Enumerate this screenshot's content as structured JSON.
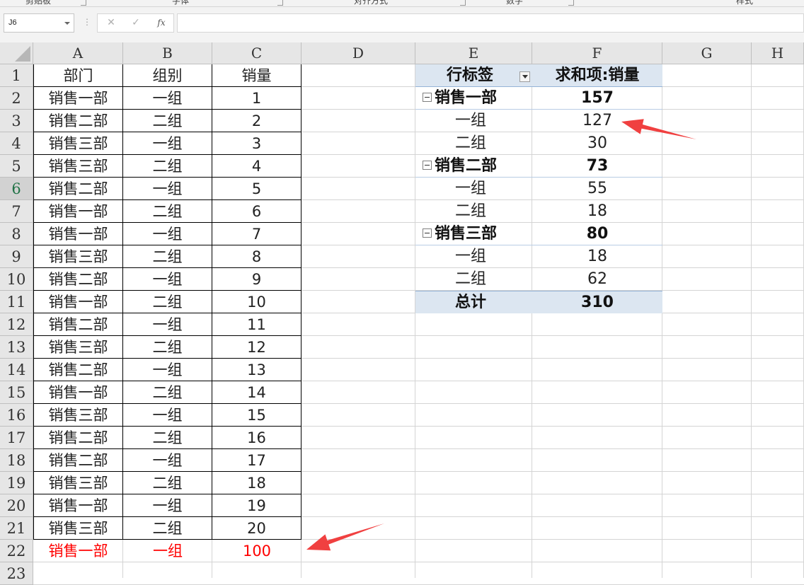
{
  "ribbon": {
    "groups": [
      "剪贴板",
      "字体",
      "对齐方式",
      "数字",
      "样式"
    ]
  },
  "formula_bar": {
    "name_box": "J6",
    "cancel_icon": "✕",
    "enter_icon": "✓",
    "fx_label": "fx",
    "formula": ""
  },
  "columns": [
    "A",
    "B",
    "C",
    "D",
    "E",
    "F",
    "G",
    "H"
  ],
  "rows": [
    "1",
    "2",
    "3",
    "4",
    "5",
    "6",
    "7",
    "8",
    "9",
    "10",
    "11",
    "12",
    "13",
    "14",
    "15",
    "16",
    "17",
    "18",
    "19",
    "20",
    "21",
    "22",
    "23"
  ],
  "active_row": "6",
  "table": {
    "headers": [
      "部门",
      "组别",
      "销量"
    ],
    "rows": [
      [
        "销售一部",
        "一组",
        "1"
      ],
      [
        "销售二部",
        "二组",
        "2"
      ],
      [
        "销售三部",
        "一组",
        "3"
      ],
      [
        "销售三部",
        "二组",
        "4"
      ],
      [
        "销售二部",
        "一组",
        "5"
      ],
      [
        "销售一部",
        "二组",
        "6"
      ],
      [
        "销售一部",
        "一组",
        "7"
      ],
      [
        "销售三部",
        "二组",
        "8"
      ],
      [
        "销售二部",
        "一组",
        "9"
      ],
      [
        "销售一部",
        "二组",
        "10"
      ],
      [
        "销售二部",
        "一组",
        "11"
      ],
      [
        "销售三部",
        "二组",
        "12"
      ],
      [
        "销售二部",
        "一组",
        "13"
      ],
      [
        "销售一部",
        "二组",
        "14"
      ],
      [
        "销售三部",
        "一组",
        "15"
      ],
      [
        "销售二部",
        "二组",
        "16"
      ],
      [
        "销售二部",
        "一组",
        "17"
      ],
      [
        "销售三部",
        "二组",
        "18"
      ],
      [
        "销售一部",
        "一组",
        "19"
      ],
      [
        "销售三部",
        "二组",
        "20"
      ]
    ],
    "new_row": [
      "销售一部",
      "一组",
      "100"
    ],
    "new_row_color": "#ff0000"
  },
  "pivot": {
    "row_label_header": "行标签",
    "value_header": "求和项:销量",
    "groups": [
      {
        "label": "销售一部",
        "total": "157",
        "items": [
          {
            "label": "一组",
            "value": "127"
          },
          {
            "label": "二组",
            "value": "30"
          }
        ]
      },
      {
        "label": "销售二部",
        "total": "73",
        "items": [
          {
            "label": "一组",
            "value": "55"
          },
          {
            "label": "二组",
            "value": "18"
          }
        ]
      },
      {
        "label": "销售三部",
        "total": "80",
        "items": [
          {
            "label": "一组",
            "value": "18"
          },
          {
            "label": "二组",
            "value": "62"
          }
        ]
      }
    ],
    "grand_total_label": "总计",
    "grand_total_value": "310",
    "header_bg": "#dce6f1"
  },
  "annotations": {
    "arrow_color": "#f04040"
  }
}
